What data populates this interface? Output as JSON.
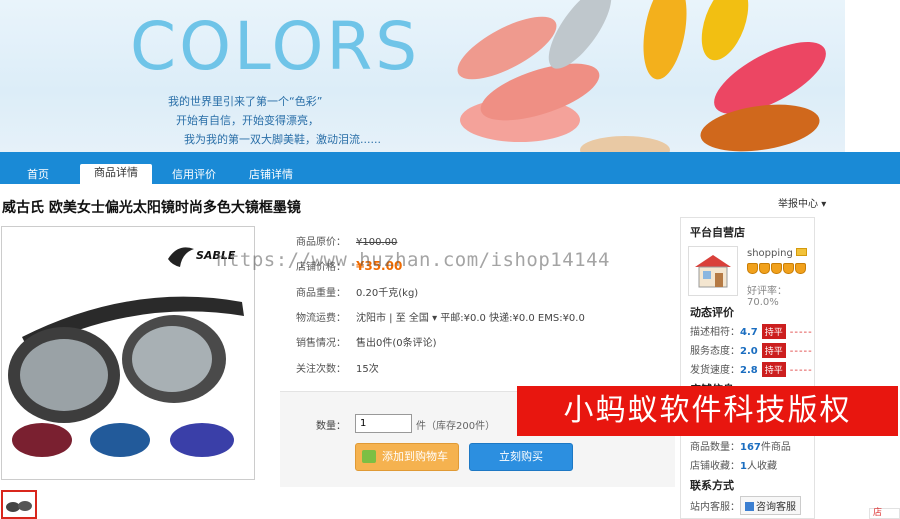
{
  "banner": {
    "title": "COLORS",
    "line1": "我的世界里引来了第一个“色彩”",
    "line2": "开始有自信，开始变得漂亮，",
    "line3": "我为我的第一双大脚美鞋，激动泪流......"
  },
  "nav": {
    "items": [
      "首页",
      "商品详情",
      "信用评价",
      "店铺详情"
    ]
  },
  "product": {
    "title": "威古氏 欧美女士偏光太阳镜时尚多色大镜框墨镜",
    "report": "举报中心",
    "brand": "SABLE",
    "rows": [
      {
        "label": "商品原价：",
        "value": "¥100.00"
      },
      {
        "label": "店铺价格：",
        "value": "¥35.00"
      },
      {
        "label": "商品重量：",
        "value": "0.20千克(kg)"
      },
      {
        "label": "物流运费：",
        "value": "沈阳市 | 至  全国 ▾  平邮:¥0.0 快递:¥0.0 EMS:¥0.0"
      },
      {
        "label": "销售情况：",
        "value": "售出0件(0条评论)"
      },
      {
        "label": "关注次数：",
        "value": "15次"
      }
    ],
    "qty_label": "数量：",
    "qty_value": "1",
    "stock": "件（库存200件）",
    "add_cart": "添加到购物车",
    "buy_now": "立刻购买"
  },
  "watermark": {
    "url": "https://www.huzhan.com/ishop14144",
    "red_banner": "小蚂蚁软件科技版权"
  },
  "shop": {
    "heading": "平台自营店",
    "name": "shopping",
    "rating": "好评率：70.0%",
    "dynamic": "动态评价",
    "scores": [
      {
        "label": "描述相符：",
        "value": "4.7",
        "tag": "持平",
        "dash": "-----"
      },
      {
        "label": "服务态度：",
        "value": "2.0",
        "tag": "持平",
        "dash": "-----"
      },
      {
        "label": "发货速度：",
        "value": "2.8",
        "tag": "持平",
        "dash": "-----"
      }
    ],
    "info_heading": "店铺信息",
    "goods_label": "商品数量：",
    "goods_count": "167",
    "goods_unit": "件商品",
    "fav_label": "店铺收藏：",
    "fav_count": "1",
    "fav_unit": "人收藏",
    "contact_heading": "联系方式",
    "kefu_label": "站内客服：",
    "kefu_button": "咨询客服"
  },
  "corner": "店"
}
